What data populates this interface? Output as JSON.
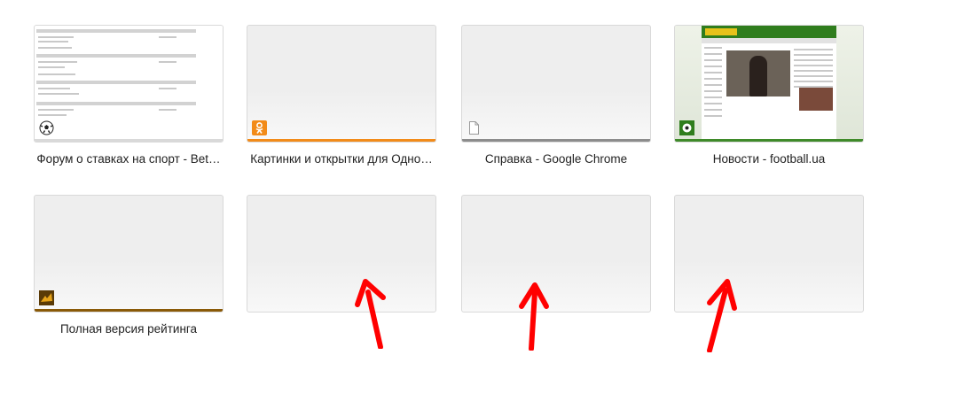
{
  "tiles": [
    {
      "title": "Форум о ставках на спорт - Bet…",
      "bar_color": "#d9d9d9",
      "favicon": "soccer-ball-icon"
    },
    {
      "title": "Картинки и открытки для Одно…",
      "bar_color": "#f28b19",
      "favicon": "odnoklassniki-icon"
    },
    {
      "title": "Справка - Google Chrome",
      "bar_color": "#8c8c8c",
      "favicon": "document-icon"
    },
    {
      "title": "Новости - football.ua",
      "bar_color": "#3f8a2a",
      "favicon": "football-ua-icon"
    },
    {
      "title": "Полная версия рейтинга",
      "bar_color": "#8a5a08",
      "favicon": "rating-icon"
    },
    {
      "title": "",
      "bar_color": "",
      "favicon": ""
    },
    {
      "title": "",
      "bar_color": "",
      "favicon": ""
    },
    {
      "title": "",
      "bar_color": "",
      "favicon": ""
    }
  ],
  "annotation": {
    "arrow_color": "#ff0000",
    "arrow_count": 3
  }
}
